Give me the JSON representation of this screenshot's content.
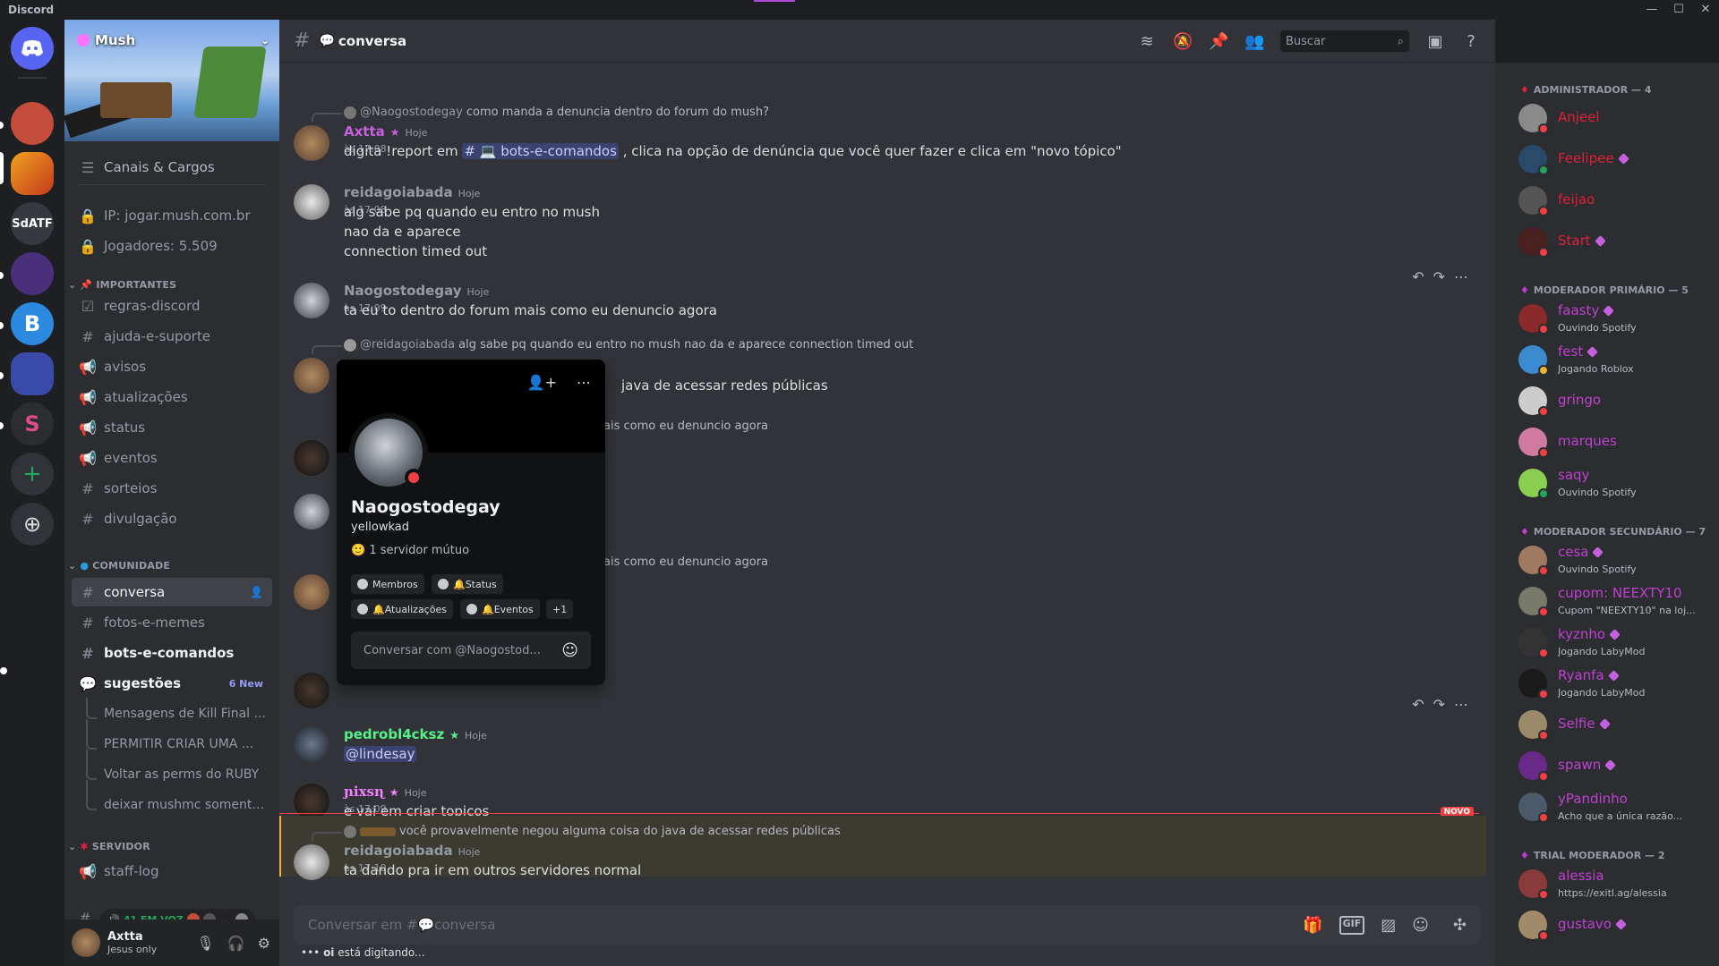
{
  "app": {
    "title": "Discord",
    "window_controls": [
      "—",
      "☐",
      "✕"
    ]
  },
  "guilds": [
    {
      "name": "home",
      "label": "",
      "color": "#5865f2"
    },
    {
      "name": "guild-1",
      "label": "",
      "color": "#c44c3a"
    },
    {
      "name": "guild-2",
      "label": "",
      "color": "#d38b2a"
    },
    {
      "name": "guild-3",
      "label": "SdATF",
      "color": "#36393f"
    },
    {
      "name": "guild-4",
      "label": "",
      "color": "#4a2f7a"
    },
    {
      "name": "guild-5",
      "label": "B",
      "color": "#2b8ae0"
    },
    {
      "name": "guild-6",
      "label": "",
      "color": "#3a4aa8"
    },
    {
      "name": "guild-7",
      "label": "S",
      "color": "#2b2d31"
    },
    {
      "name": "add",
      "label": "+",
      "color": "#313338"
    },
    {
      "name": "explore",
      "label": "⊕",
      "color": "#313338"
    }
  ],
  "server": {
    "name": "Mush",
    "channels_roles": "Canais & Cargos",
    "ip": "IP: jogar.mush.com.br",
    "players": "Jogadores: 5.509"
  },
  "categories": {
    "important": "IMPORTANTES",
    "community": "COMUNIDADE",
    "server": "SERVIDOR"
  },
  "channels_important": [
    "regras-discord",
    "ajuda-e-suporte",
    "avisos",
    "atualizações",
    "status",
    "eventos",
    "sorteios",
    "divulgação"
  ],
  "channels_community": {
    "conversa": "conversa",
    "memes": "fotos-e-memes",
    "bots": "bots-e-comandos",
    "sugestoes": "sugestões",
    "new": "6 New"
  },
  "threads": [
    "Mensagens de Kill Final ...",
    "PERMITIR CRIAR UMA ...",
    "Voltar as perms do RUBY",
    "deixar mushmc somente..."
  ],
  "server_channels": {
    "staff": "staff-log",
    "voice": "41 EM VOZ"
  },
  "user": {
    "name": "Axtta",
    "status": "Jesus only"
  },
  "header": {
    "channel": "conversa",
    "search_placeholder": "Buscar"
  },
  "messages": {
    "m1": {
      "reply_to": "@Naogostodegay",
      "reply_text": "como manda a denuncia dentro do forum do mush?",
      "author": "Axtta",
      "time": "Hoje às 17:08",
      "pre": "digita !report em",
      "mention": "# 💻 bots-e-comandos",
      "post": ", clica na opção de denúncia que você quer fazer e clica em \"novo tópico\""
    },
    "m2": {
      "author": "reidagoiabada",
      "time": "Hoje às 17:08",
      "lines": [
        "alg sabe pq quando eu entro no mush",
        "nao da e aparece",
        "connection timed out"
      ]
    },
    "m3": {
      "author": "Naogostodegay",
      "time": "Hoje às 17:09",
      "text": "ta eu to dentro do forum mais como eu denuncio agora"
    },
    "m4": {
      "reply_to": "@reidagoiabada",
      "reply_text": "alg sabe pq quando eu entro no mush nao da e aparece connection timed out",
      "partial": "java de acessar redes públicas"
    },
    "m5": {
      "partial": "ais como eu denuncio agora"
    },
    "m6": {
      "partial": "ais como eu denuncio agora"
    },
    "m7": {
      "author": "pedrobl4cksz",
      "time": "Hoje às 17:09",
      "mention": "@lindesay"
    },
    "m8": {
      "author": "ɲixsɳ",
      "time": "Hoje às 17:09",
      "text": "e  vai em criar topicos"
    },
    "m9": {
      "reply_text": "você provavelmente negou alguma coisa do java de acessar redes públicas",
      "author": "reidagoiabada",
      "time": "Hoje às 17:10",
      "text": "ta dando pra ir em outros servidores normal"
    }
  },
  "new_label": "NOVO",
  "composer": {
    "placeholder": "Conversar em #💬conversa",
    "typing_user": "oi",
    "typing_text": " está digitando..."
  },
  "popup": {
    "name": "Naogostodegay",
    "username": "yellowkad",
    "mutual": "1 servidor mútuo",
    "roles": [
      "Membros",
      "🔔Status",
      "🔔Atualizações",
      "🔔Eventos",
      "+1"
    ],
    "input": "Conversar com @Naogostod..."
  },
  "member_groups": [
    {
      "title": "ADMINISTRADOR — 4",
      "color": "#e0203a",
      "members": [
        {
          "name": "Anjeel",
          "activity": ""
        },
        {
          "name": "Feelipee",
          "activity": ""
        },
        {
          "name": "feijao",
          "activity": ""
        },
        {
          "name": "Start",
          "activity": ""
        }
      ]
    },
    {
      "title": "MODERADOR PRIMÁRIO — 5",
      "color": "#c040d0",
      "members": [
        {
          "name": "faasty",
          "activity": "Ouvindo Spotify"
        },
        {
          "name": "fest",
          "activity": "Jogando Roblox"
        },
        {
          "name": "gringo",
          "activity": ""
        },
        {
          "name": "marques",
          "activity": ""
        },
        {
          "name": "saqy",
          "activity": "Ouvindo Spotify"
        }
      ]
    },
    {
      "title": "MODERADOR SECUNDÁRIO — 7",
      "color": "#c040d0",
      "members": [
        {
          "name": "cesa",
          "activity": "Ouvindo Spotify"
        },
        {
          "name": "cupom: NEEXTY10",
          "activity": "Cupom \"NEEXTY10\" na loj..."
        },
        {
          "name": "kyznho",
          "activity": "Jogando LabyMod"
        },
        {
          "name": "Ryanfa",
          "activity": "Jogando LabyMod"
        },
        {
          "name": "Selfie",
          "activity": ""
        },
        {
          "name": "spawn",
          "activity": ""
        },
        {
          "name": "yPandinho",
          "activity": "Acho que a única razão..."
        }
      ]
    },
    {
      "title": "TRIAL MODERADOR — 2",
      "color": "#c040d0",
      "members": [
        {
          "name": "alessia",
          "activity": "https://exitl.ag/alessia"
        },
        {
          "name": "gustavo",
          "activity": ""
        }
      ]
    }
  ]
}
